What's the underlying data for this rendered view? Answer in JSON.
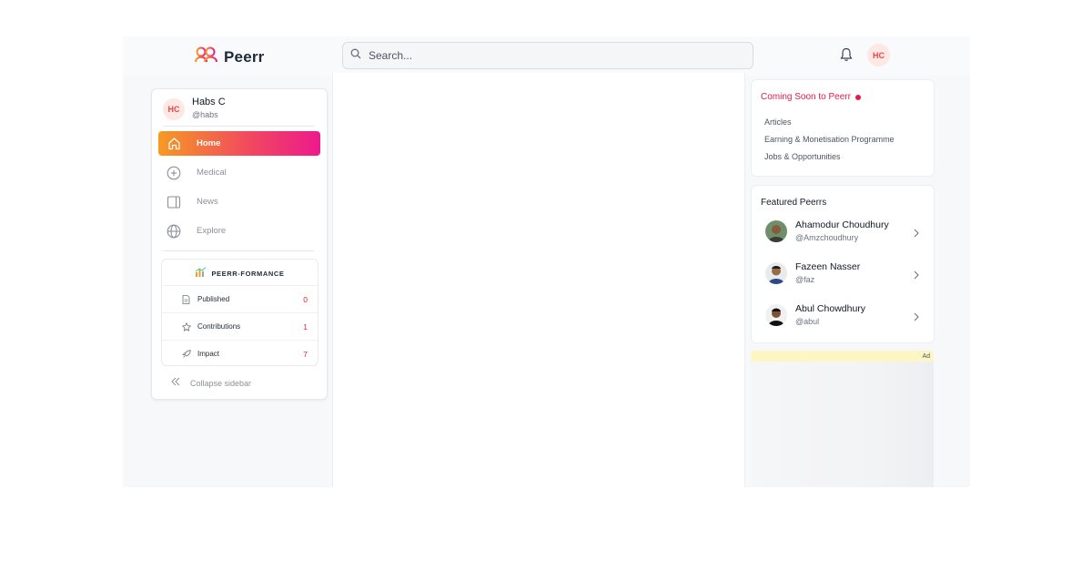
{
  "brand": {
    "name": "Peerr",
    "logo_icon": "peerr-logo-icon",
    "accent_from": "#f59a23",
    "accent_to": "#ec1a8c"
  },
  "search": {
    "placeholder": "Search..."
  },
  "header": {
    "avatar_initials": "HC"
  },
  "user": {
    "initials": "HC",
    "name": "Habs C",
    "handle": "@habs"
  },
  "nav": [
    {
      "label": "Home",
      "icon": "home-icon",
      "active": true
    },
    {
      "label": "Medical",
      "icon": "plus-circle-icon",
      "active": false
    },
    {
      "label": "News",
      "icon": "newspaper-icon",
      "active": false
    },
    {
      "label": "Explore",
      "icon": "globe-icon",
      "active": false
    }
  ],
  "performance": {
    "title": "PEERR-FORMANCE",
    "rows": [
      {
        "label": "Published",
        "value": "0",
        "icon": "document-icon"
      },
      {
        "label": "Contributions",
        "value": "1",
        "icon": "star-icon"
      },
      {
        "label": "Impact",
        "value": "7",
        "icon": "rocket-icon"
      }
    ]
  },
  "collapse_label": "Collapse sidebar",
  "coming_soon": {
    "title": "Coming Soon to Peerr",
    "items": [
      "Articles",
      "Earning & Monetisation Programme",
      "Jobs & Opportunities"
    ]
  },
  "featured": {
    "title": "Featured Peerrs",
    "people": [
      {
        "name": "Ahamodur Choudhury",
        "handle": "@Amzchoudhury"
      },
      {
        "name": "Fazeen Nasser",
        "handle": "@faz"
      },
      {
        "name": "Abul Chowdhury",
        "handle": "@abul"
      }
    ]
  },
  "ad": {
    "label": "Ad"
  }
}
